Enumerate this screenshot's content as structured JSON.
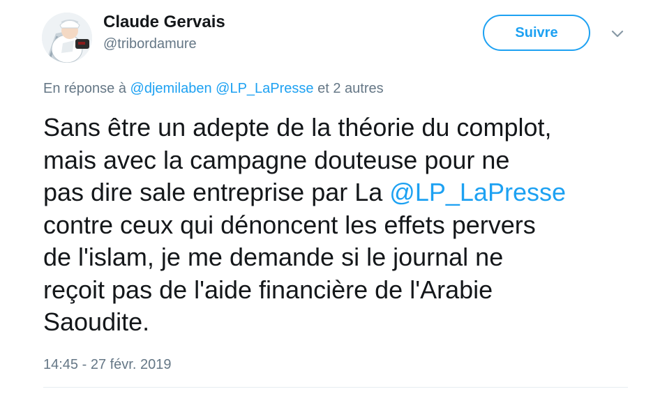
{
  "author": {
    "display_name": "Claude Gervais",
    "screen_name": "@tribordamure"
  },
  "actions": {
    "follow_label": "Suivre",
    "menu_icon": "chevron-down-icon"
  },
  "reply_context": {
    "prefix": "En réponse à",
    "mention_1": "@djemilaben",
    "mention_2": "@LP_LaPresse",
    "suffix": "et 2 autres"
  },
  "tweet": {
    "line_1": "Sans être un adepte de la théorie du complot,",
    "line_2": "mais avec la campagne douteuse pour ne",
    "line_3_before": "pas dire sale entreprise par La ",
    "line_3_mention": "@LP_LaPresse",
    "line_4": "contre ceux qui dénoncent les effets pervers",
    "line_5": "de l'islam, je me demande si le journal ne",
    "line_6": "reçoit pas de l'aide financière de l'Arabie",
    "line_7": "Saoudite."
  },
  "timestamp": "14:45 - 27 févr. 2019",
  "colors": {
    "accent": "#1da1f2",
    "text": "#14171a",
    "secondary_text": "#657786",
    "divider": "#e6ecf0"
  }
}
